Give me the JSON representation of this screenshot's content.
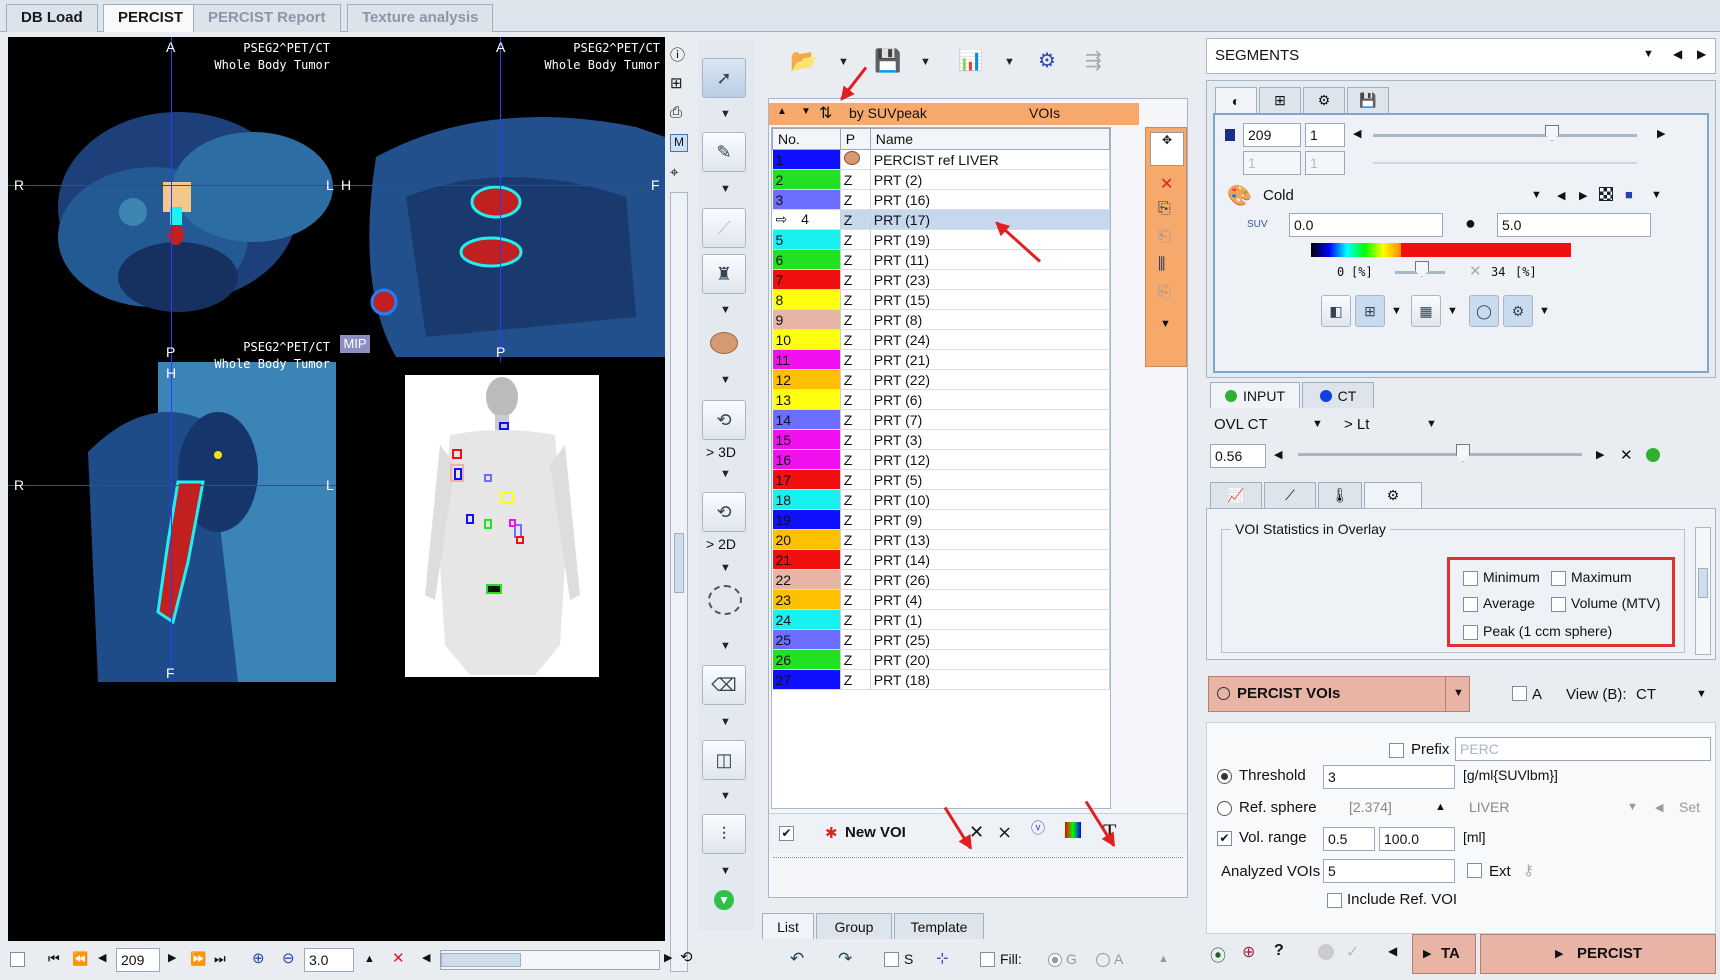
{
  "tabs": [
    "DB Load",
    "PERCIST",
    "PERCIST Report",
    "Texture analysis"
  ],
  "viewer": {
    "patient": "PSEG2^PET/CT",
    "study": "Whole Body Tumor",
    "mip_label": "MIP",
    "orient": {
      "a": "A",
      "p": "P",
      "r": "R",
      "l": "L",
      "h": "H",
      "f": "F"
    },
    "slice": "209",
    "zoom": "3.0"
  },
  "tools": {
    "to3d": "> 3D",
    "to2d": "> 2D"
  },
  "voi_list": {
    "sort_label": "by SUVpeak",
    "title": "VOIs",
    "columns": [
      "No.",
      "P",
      "Name"
    ],
    "rows": [
      {
        "no": "1",
        "p": "",
        "name": "PERCIST ref LIVER",
        "color": "#1010ff"
      },
      {
        "no": "2",
        "p": "Z",
        "name": "PRT (2)",
        "color": "#22e022"
      },
      {
        "no": "3",
        "p": "Z",
        "name": "PRT (16)",
        "color": "#6d6dff"
      },
      {
        "no": "4",
        "p": "Z",
        "name": "PRT (17)",
        "color": "#e8b4a6"
      },
      {
        "no": "5",
        "p": "Z",
        "name": "PRT (19)",
        "color": "#19f0f0"
      },
      {
        "no": "6",
        "p": "Z",
        "name": "PRT (11)",
        "color": "#22e022"
      },
      {
        "no": "7",
        "p": "Z",
        "name": "PRT (23)",
        "color": "#f01010"
      },
      {
        "no": "8",
        "p": "Z",
        "name": "PRT (15)",
        "color": "#ffff10"
      },
      {
        "no": "9",
        "p": "Z",
        "name": "PRT (8)",
        "color": "#e8b4a6"
      },
      {
        "no": "10",
        "p": "Z",
        "name": "PRT (24)",
        "color": "#ffff10"
      },
      {
        "no": "11",
        "p": "Z",
        "name": "PRT (21)",
        "color": "#f010f0"
      },
      {
        "no": "12",
        "p": "Z",
        "name": "PRT (22)",
        "color": "#ffc000"
      },
      {
        "no": "13",
        "p": "Z",
        "name": "PRT (6)",
        "color": "#ffff10"
      },
      {
        "no": "14",
        "p": "Z",
        "name": "PRT (7)",
        "color": "#6d6dff"
      },
      {
        "no": "15",
        "p": "Z",
        "name": "PRT (3)",
        "color": "#f010f0"
      },
      {
        "no": "16",
        "p": "Z",
        "name": "PRT (12)",
        "color": "#f010f0"
      },
      {
        "no": "17",
        "p": "Z",
        "name": "PRT (5)",
        "color": "#f01010"
      },
      {
        "no": "18",
        "p": "Z",
        "name": "PRT (10)",
        "color": "#19f0f0"
      },
      {
        "no": "19",
        "p": "Z",
        "name": "PRT (9)",
        "color": "#1010ff"
      },
      {
        "no": "20",
        "p": "Z",
        "name": "PRT (13)",
        "color": "#ffc000"
      },
      {
        "no": "21",
        "p": "Z",
        "name": "PRT (14)",
        "color": "#f01010"
      },
      {
        "no": "22",
        "p": "Z",
        "name": "PRT (26)",
        "color": "#e8b4a6"
      },
      {
        "no": "23",
        "p": "Z",
        "name": "PRT (4)",
        "color": "#ffc000"
      },
      {
        "no": "24",
        "p": "Z",
        "name": "PRT (1)",
        "color": "#19f0f0"
      },
      {
        "no": "25",
        "p": "Z",
        "name": "PRT (25)",
        "color": "#6d6dff"
      },
      {
        "no": "26",
        "p": "Z",
        "name": "PRT (20)",
        "color": "#22e022"
      },
      {
        "no": "27",
        "p": "Z",
        "name": "PRT (18)",
        "color": "#1010ff"
      }
    ],
    "selected_index": 3,
    "new_voi": "New VOI",
    "bottom_tabs": [
      "List",
      "Group",
      "Template"
    ]
  },
  "right": {
    "segments": "SEGMENTS",
    "frame": "209",
    "frame2": "1",
    "disabled1": "1",
    "disabled2": "1",
    "colormap": "Cold",
    "suv_min": "0.0",
    "suv_max": "5.0",
    "pct_min": "0",
    "pct_max": "34",
    "pct_unit": "[%]",
    "input_tab": "INPUT",
    "ct_tab": "CT",
    "ovl": "OVL CT",
    "lt": "> Lt",
    "ovl_value": "0.56",
    "stats_title": "VOI Statistics in Overlay",
    "stats": [
      "Minimum",
      "Maximum",
      "Average",
      "Volume (MTV)",
      "Peak (1 ccm sphere)"
    ],
    "percist_vois": "PERCIST VOIs",
    "a": "A",
    "view_label": "View (B):",
    "view_value": "CT",
    "prefix": "Prefix",
    "prefix_value": "PERC",
    "threshold": "Threshold",
    "threshold_value": "3",
    "threshold_unit": "[g/ml{SUVlbm}]",
    "ref_sphere": "Ref. sphere",
    "ref_value": "[2.374]",
    "liver": "LIVER",
    "set": "Set",
    "vol_range": "Vol. range",
    "vol_min": "0.5",
    "vol_max": "100.0",
    "vol_unit": "[ml]",
    "analyzed": "Analyzed VOIs",
    "analyzed_value": "5",
    "ext": "Ext",
    "include_ref": "Include Ref. VOI",
    "ta": "TA",
    "percist_btn": "PERCIST"
  },
  "bottom": {
    "s": "S",
    "fill": "Fill:",
    "g": "G",
    "a": "A"
  }
}
